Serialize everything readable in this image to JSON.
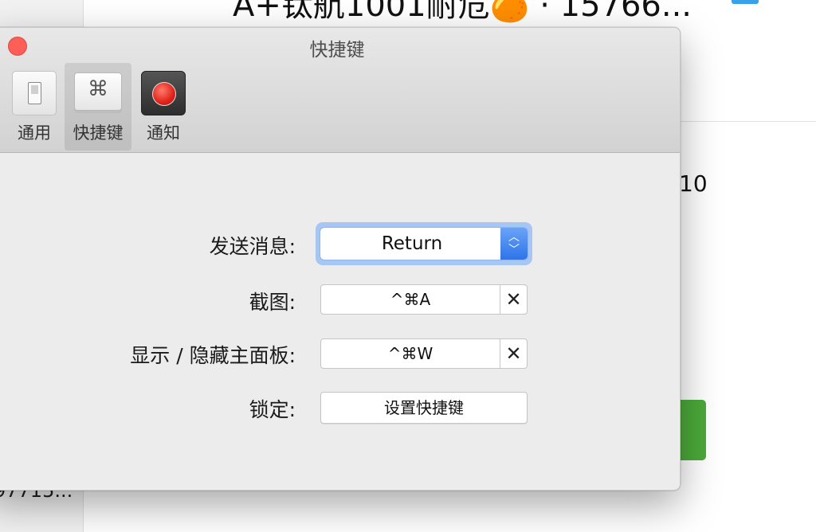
{
  "background": {
    "title_text": "A+钛航1001耐危🍊 · 15766...",
    "side_number": "10",
    "left_text": "97715..."
  },
  "window": {
    "title": "快捷键"
  },
  "toolbar": {
    "items": [
      {
        "label": "通用",
        "icon": "toggle-switch-icon"
      },
      {
        "label": "快捷键",
        "icon": "command-key-icon",
        "glyph": "⌘",
        "selected": true
      },
      {
        "label": "通知",
        "icon": "record-dot-icon"
      }
    ]
  },
  "form": {
    "send_message": {
      "label": "发送消息:",
      "value": "Return",
      "arrows_up": "︿",
      "arrows_down": "﹀"
    },
    "screenshot": {
      "label": "截图:",
      "value": "^⌘A",
      "clear": "✕"
    },
    "toggle_panel": {
      "label": "显示 / 隐藏主面板:",
      "value": "^⌘W",
      "clear": "✕"
    },
    "lock": {
      "label": "锁定:",
      "button": "设置快捷键"
    }
  },
  "colors": {
    "close_button": "#fc5f57",
    "popup_accent": "#2e74ea",
    "background_green": "#4caa3a"
  }
}
